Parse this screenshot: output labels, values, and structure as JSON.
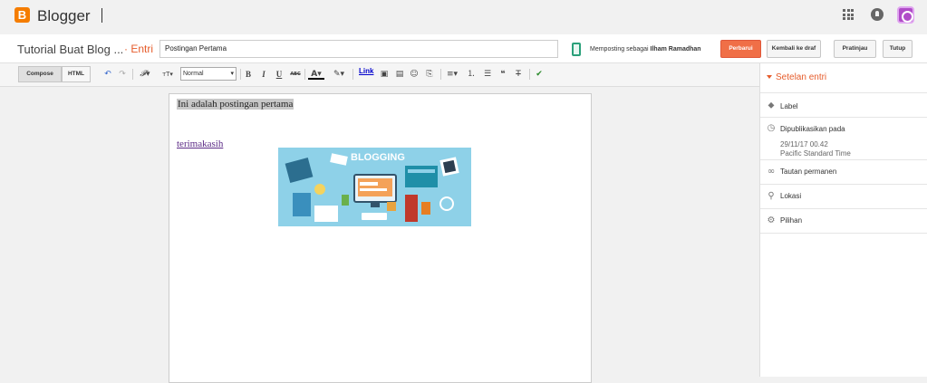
{
  "app": {
    "name": "Blogger",
    "logo_letter": "B"
  },
  "topbar": {
    "apps_icon": "apps-grid-icon",
    "notifications_icon": "bell-icon",
    "account_icon": "avatar"
  },
  "header": {
    "blog_title": "Tutorial Buat Blog ...",
    "section": "· Entri",
    "post_title_value": "Postingan Pertama",
    "posting_as_prefix": "Memposting sebagai",
    "posting_as_user": "Ilham Ramadhan",
    "buttons": {
      "publish": "Perbarui",
      "revert_draft": "Kembali ke draf",
      "preview": "Pratinjau",
      "close": "Tutup"
    }
  },
  "toolbar": {
    "compose": "Compose",
    "html": "HTML",
    "font_size_value": "Normal",
    "link": "Link",
    "bold": "B",
    "italic": "I",
    "underline": "U",
    "strike": "ABC"
  },
  "editor": {
    "line1": "Ini adalah postingan pertama",
    "line2": "terimakasih",
    "image_text": "BLOGGING"
  },
  "sidebar": {
    "title": "Setelan entri",
    "items": [
      {
        "label": "Label",
        "icon": "tag-icon"
      },
      {
        "label": "Dipublikasikan pada",
        "icon": "clock-icon",
        "date": "29/11/17 00.42",
        "timezone": "Pacific Standard Time"
      },
      {
        "label": "Tautan permanen",
        "icon": "link-icon"
      },
      {
        "label": "Lokasi",
        "icon": "location-pin-icon"
      },
      {
        "label": "Pilihan",
        "icon": "gear-icon"
      }
    ]
  },
  "colors": {
    "accent": "#e65c2b",
    "publish_button": "#f06f47",
    "brand": "#f57d00"
  }
}
